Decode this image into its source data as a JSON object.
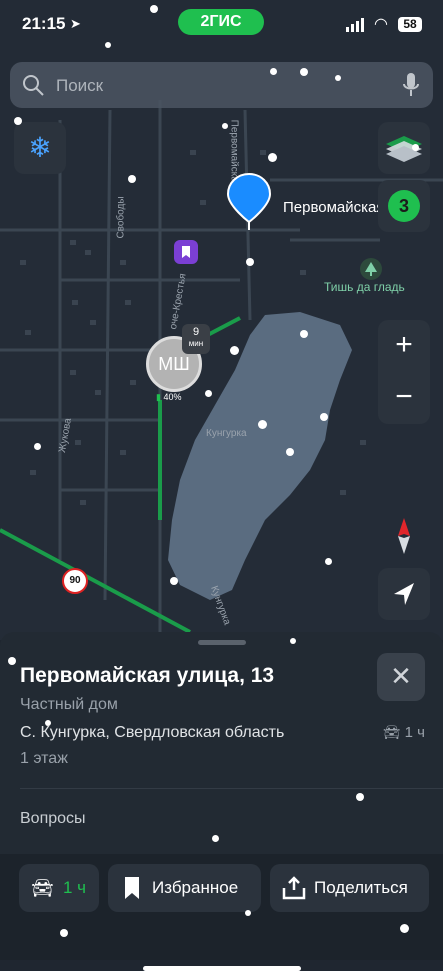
{
  "status_bar": {
    "time": "21:15",
    "app_badge": "2ГИС",
    "battery": "58"
  },
  "search": {
    "placeholder": "Поиск"
  },
  "map": {
    "pin_label": "Первомайская ца",
    "poi_label": "Тишь да гладь",
    "street_labels": [
      "Свободы",
      "Первомайская",
      "оче-Крестья",
      "Жукова",
      "Кунгурка",
      "Кунгурка"
    ],
    "place_badge": {
      "initials": "МШ",
      "minutes": "9",
      "minutes_unit": "мин",
      "charge": "40%"
    },
    "speed_limit": "90",
    "layers_count": "3"
  },
  "card": {
    "title": "Первомайская улица, 13",
    "subtitle": "Частный дом",
    "address": "С. Кунгурка, Свердловская область",
    "car_time": "1 ч",
    "floors": "1 этаж",
    "questions": "Вопросы",
    "actions": {
      "car_time": "1 ч",
      "favorite": "Избранное",
      "share": "Поделиться"
    }
  },
  "colors": {
    "accent": "#1fbf4f",
    "pin": "#1a8cff",
    "poi": "#7fd0a8",
    "route": "#1a9c4a"
  }
}
